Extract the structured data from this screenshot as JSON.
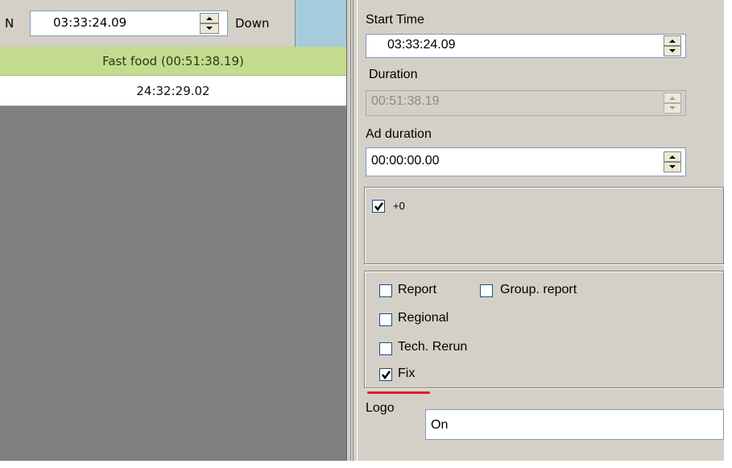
{
  "left": {
    "toolbar": {
      "n_label": "N",
      "time_value": "03:33:24.09",
      "direction_label": "Down"
    },
    "rows": {
      "fastfood": "Fast food (00:51:38.19)",
      "total": "24:32:29.02"
    }
  },
  "right": {
    "start_time_label": "Start Time",
    "start_time_value": "03:33:24.09",
    "duration_label": "Duration",
    "duration_value": "00:51:38.19",
    "ad_duration_label": "Ad duration",
    "ad_duration_value": "00:00:00.00",
    "plus_option": {
      "label": "+0",
      "checked": true
    },
    "options": {
      "report": {
        "label": "Report",
        "checked": false
      },
      "group_report": {
        "label": "Group. report",
        "checked": false
      },
      "regional": {
        "label": "Regional",
        "checked": false
      },
      "tech_rerun": {
        "label": "Tech. Rerun",
        "checked": false
      },
      "fix": {
        "label": "Fix",
        "checked": true
      }
    },
    "logo_label": "Logo",
    "logo_value": "On"
  },
  "colors": {
    "fastfood_row": "#c3dc8f",
    "header_blue": "#a6cbdc",
    "panel": "#d4d0c8",
    "empty_area": "#808080",
    "highlight_underline": "#e02020"
  }
}
